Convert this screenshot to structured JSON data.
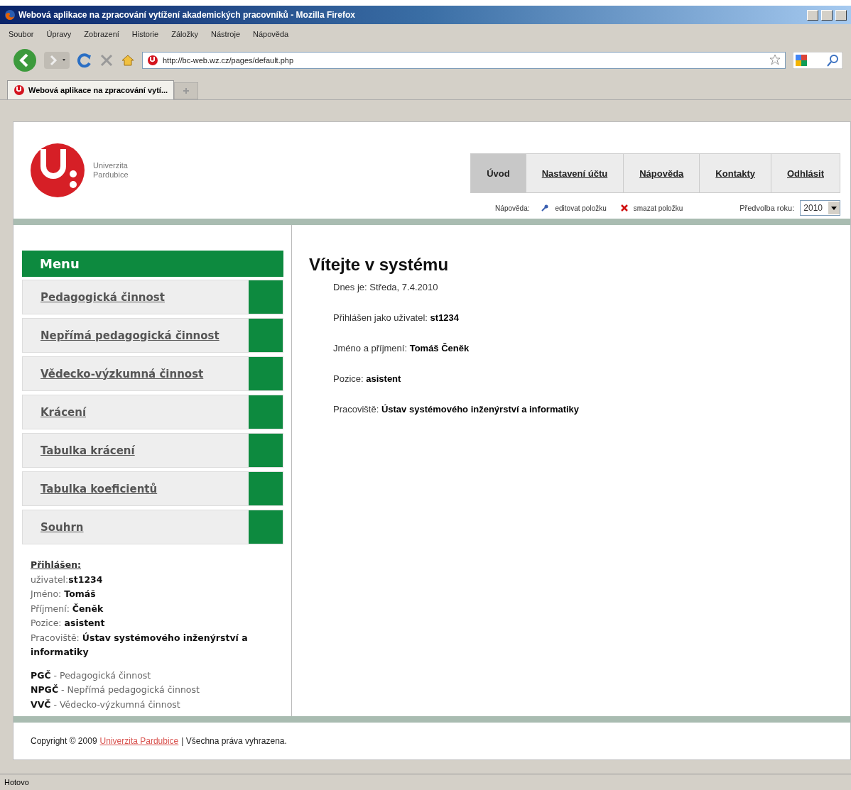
{
  "window": {
    "title": "Webová aplikace na zpracování vytížení akademických pracovníků - Mozilla Firefox"
  },
  "menu_bar": [
    "Soubor",
    "Úpravy",
    "Zobrazení",
    "Historie",
    "Záložky",
    "Nástroje",
    "Nápověda"
  ],
  "address": {
    "url": "http://bc-web.wz.cz/pages/default.php"
  },
  "browser_tabs": [
    {
      "title": "Webová aplikace na zpracování vytí...",
      "selected": true
    }
  ],
  "page": {
    "logo": {
      "lines": [
        "Univerzita",
        "Pardubice"
      ]
    },
    "nav_tabs": [
      {
        "label": "Úvod",
        "selected": true
      },
      {
        "label": "Nastavení účtu",
        "selected": false
      },
      {
        "label": "Nápověda",
        "selected": false
      },
      {
        "label": "Kontakty",
        "selected": false
      },
      {
        "label": "Odhlásit",
        "selected": false
      }
    ],
    "legend": {
      "label": "Nápověda:",
      "items": [
        {
          "kind": "edit",
          "label": "editovat položku"
        },
        {
          "kind": "delete",
          "label": "smazat položku"
        }
      ]
    },
    "year_select": {
      "label": "Předvolba roku:",
      "value": "2010"
    },
    "menu": {
      "title": "Menu",
      "items": [
        "Pedagogická činnost",
        "Nepřímá pedagogická činnost",
        "Vědecko-výzkumná činnost",
        "Krácení",
        "Tabulka krácení",
        "Tabulka koeficientů",
        "Souhrn"
      ]
    },
    "logged_in": {
      "heading": "Přihlášen:",
      "fields": [
        "uživatel:**st1234**",
        "Jméno: **Tomáš**",
        "Příjmení: **Čeněk**",
        "Pozice: **asistent**",
        "Pracoviště: **Ústav systémového inženýrství a informatiky**"
      ],
      "abbreviations": [
        "**PGČ** - Pedagogická činnost",
        "**NPGČ** - Nepřímá pedagogická činnost",
        "**VVČ** - Vědecko-výzkumná činnost"
      ]
    },
    "main": {
      "heading": "Vítejte v systému",
      "lines": [
        "Dnes je: Středa, 7.4.2010",
        "Přihlášen jako uživatel: **st1234**",
        "Jméno a příjmení: **Tomáš Čeněk**",
        "Pozice: **asistent**",
        "Pracoviště: **Ústav systémového inženýrství a informatiky**"
      ]
    },
    "footer": {
      "prefix": "Copyright © 2009",
      "link": "Univerzita Pardubice",
      "suffix": "| Všechna práva vyhrazena."
    }
  },
  "status_bar": {
    "text": "Hotovo"
  }
}
